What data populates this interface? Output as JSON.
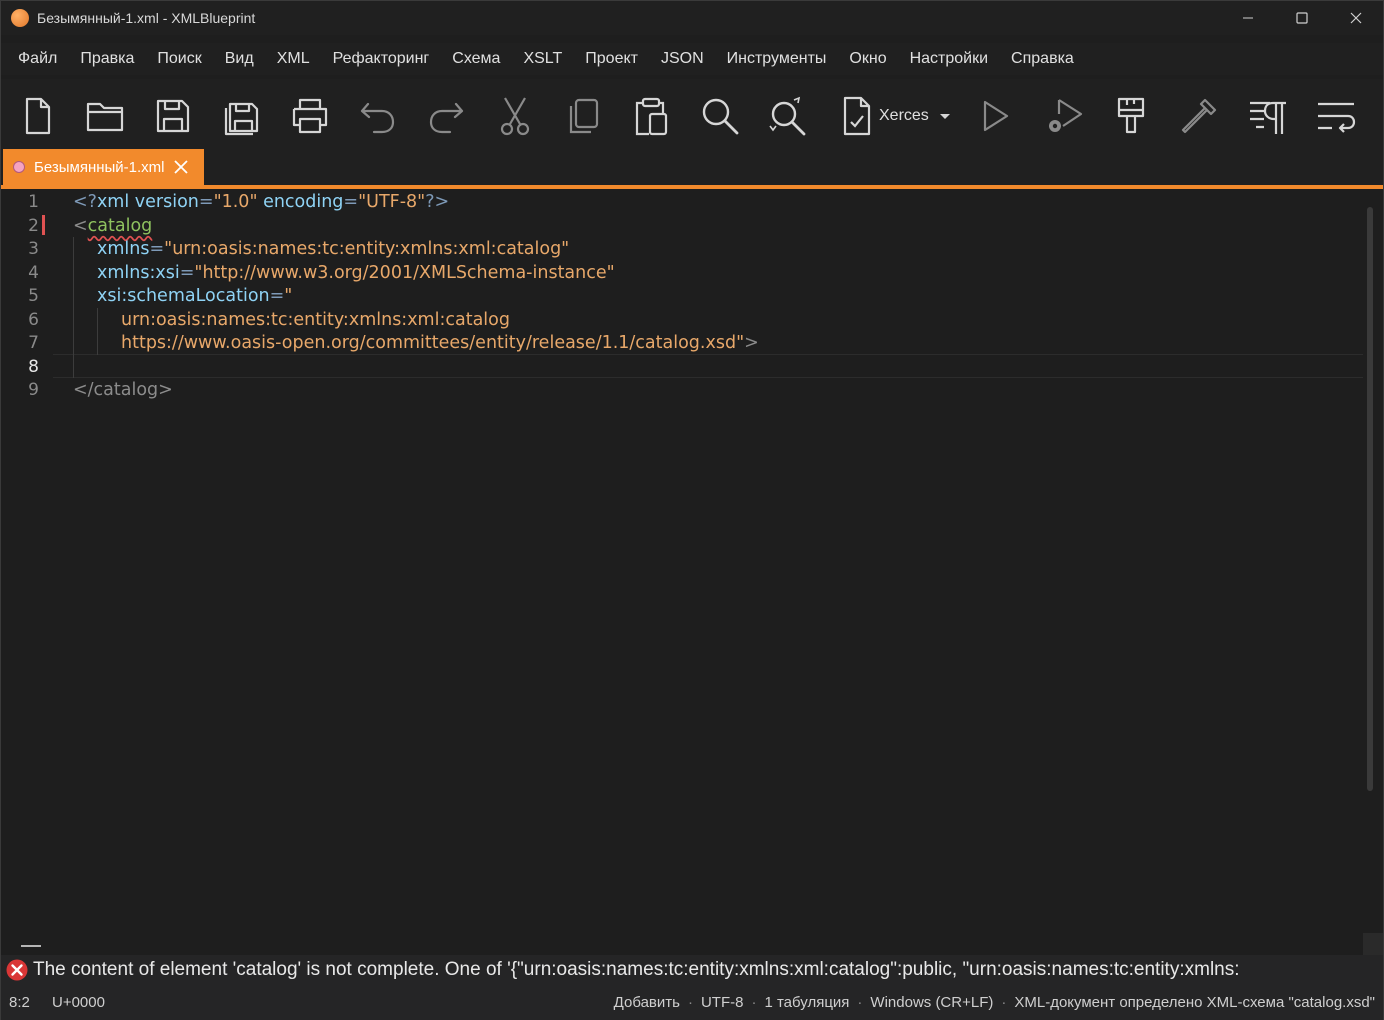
{
  "window": {
    "title": "Безымянный-1.xml - XMLBlueprint"
  },
  "menu": [
    "Файл",
    "Правка",
    "Поиск",
    "Вид",
    "XML",
    "Рефакторинг",
    "Схема",
    "XSLT",
    "Проект",
    "JSON",
    "Инструменты",
    "Окно",
    "Настройки",
    "Справка"
  ],
  "toolbar": {
    "buttons": [
      "new-file-icon",
      "open-folder-icon",
      "save-icon",
      "save-all-icon",
      "print-icon",
      "undo-icon",
      "redo-icon",
      "cut-icon",
      "copy-icon",
      "paste-icon",
      "find-icon",
      "replace-icon",
      "validate-icon",
      "run-icon",
      "run-settings-icon",
      "format-icon",
      "color-picker-icon",
      "show-whitespace-icon",
      "word-wrap-icon"
    ],
    "validator_label": "Xerces"
  },
  "tab": {
    "label": "Безымянный-1.xml"
  },
  "editor": {
    "line_numbers": [
      "1",
      "2",
      "3",
      "4",
      "5",
      "6",
      "7",
      "8",
      "9"
    ],
    "active_line": "8",
    "lines": {
      "l1": {
        "open": "<?",
        "name": "xml",
        "a1": " version",
        "eq1": "=",
        "v1": "\"1.0\"",
        "a2": " encoding",
        "eq2": "=",
        "v2": "\"UTF-8\"",
        "close": "?>"
      },
      "l2": {
        "open": "<",
        "name": "catalog"
      },
      "l3": {
        "attr": "xmlns",
        "eq": "=",
        "val": "\"urn:oasis:names:tc:entity:xmlns:xml:catalog\""
      },
      "l4": {
        "attr": "xmlns:xsi",
        "eq": "=",
        "val": "\"http://www.w3.org/2001/XMLSchema-instance\""
      },
      "l5": {
        "attr": "xsi:schemaLocation",
        "eq": "=",
        "val": "\""
      },
      "l6": {
        "val": "urn:oasis:names:tc:entity:xmlns:xml:catalog"
      },
      "l7": {
        "val": "https://www.oasis-open.org/committees/entity/release/1.1/catalog.xsd\"",
        "close": ">"
      },
      "l9": {
        "text": "</catalog>"
      }
    }
  },
  "error": {
    "message": "The content of element 'catalog' is not complete. One of '{\"urn:oasis:names:tc:entity:xmlns:xml:catalog\":public, \"urn:oasis:names:tc:entity:xmlns:"
  },
  "status": {
    "position": "8:2",
    "codepoint": "U+0000",
    "mode": "Добавить",
    "encoding": "UTF-8",
    "indent": "1 табуляция",
    "line_endings": "Windows (CR+LF)",
    "schema": "XML-документ определено XML-схема \"catalog.xsd\""
  },
  "colors": {
    "accent": "#f28a2c",
    "error": "#e05252",
    "tag": "#8fc25f",
    "attribute": "#8fd3f5",
    "string": "#e8a86a"
  }
}
